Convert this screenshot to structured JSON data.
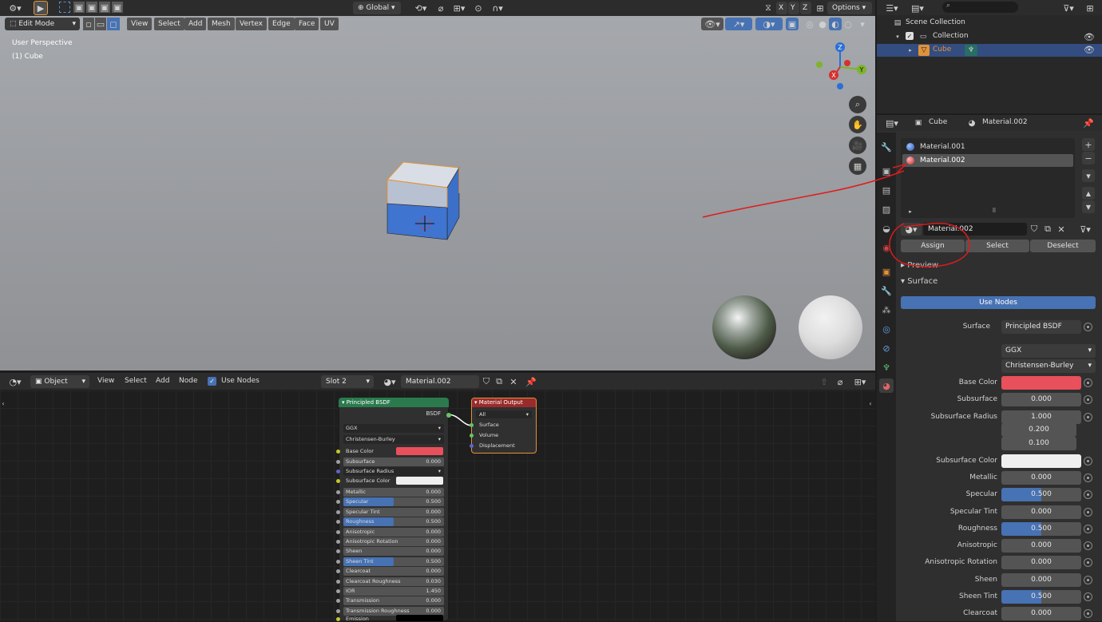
{
  "viewport": {
    "mode": "Edit Mode",
    "menus": [
      "View",
      "Select",
      "Add",
      "Mesh",
      "Vertex",
      "Edge",
      "Face",
      "UV"
    ],
    "transform_orientation": "Global",
    "options_label": "Options",
    "axis_labels": [
      "X",
      "Y",
      "Z"
    ],
    "perspective_label": "User Perspective",
    "object_label": "(1) Cube",
    "gizmo": {
      "x": "X",
      "y": "Y",
      "z": "Z"
    }
  },
  "outliner": {
    "scene_collection": "Scene Collection",
    "collection": "Collection",
    "object": "Cube"
  },
  "properties": {
    "breadcrumb_object": "Cube",
    "breadcrumb_material": "Material.002",
    "slots": [
      "Material.001",
      "Material.002"
    ],
    "material_name": "Material.002",
    "assign_label": "Assign",
    "select_label": "Select",
    "deselect_label": "Deselect",
    "preview_label": "Preview",
    "surface_panel_label": "Surface",
    "use_nodes_label": "Use Nodes",
    "surface_label": "Surface",
    "surface_value": "Principled BSDF",
    "distribution": "GGX",
    "subsurface_method": "Christensen-Burley",
    "rows": [
      {
        "label": "Base Color",
        "type": "color",
        "color": "#e8505b"
      },
      {
        "label": "Subsurface",
        "value": "0.000",
        "fill": 0
      },
      {
        "label": "Subsurface Radius",
        "value": "1.000",
        "fill": 0
      },
      {
        "label": "",
        "value": "0.200",
        "fill": 0
      },
      {
        "label": "",
        "value": "0.100",
        "fill": 0
      },
      {
        "label": "Subsurface Color",
        "type": "color",
        "color": "#efefef"
      },
      {
        "label": "Metallic",
        "value": "0.000",
        "fill": 0
      },
      {
        "label": "Specular",
        "value": "0.500",
        "fill": 0.5
      },
      {
        "label": "Specular Tint",
        "value": "0.000",
        "fill": 0
      },
      {
        "label": "Roughness",
        "value": "0.500",
        "fill": 0.5
      },
      {
        "label": "Anisotropic",
        "value": "0.000",
        "fill": 0
      },
      {
        "label": "Anisotropic Rotation",
        "value": "0.000",
        "fill": 0
      },
      {
        "label": "Sheen",
        "value": "0.000",
        "fill": 0
      },
      {
        "label": "Sheen Tint",
        "value": "0.500",
        "fill": 0.5
      },
      {
        "label": "Clearcoat",
        "value": "0.000",
        "fill": 0
      }
    ]
  },
  "node_editor": {
    "object_mode": "Object",
    "menus": [
      "View",
      "Select",
      "Add",
      "Node"
    ],
    "use_nodes_label": "Use Nodes",
    "slot": "Slot 2",
    "material": "Material.002",
    "bsdf_node": {
      "title": "Principled BSDF",
      "output_label": "BSDF",
      "distribution": "GGX",
      "subsurface_method": "Christensen-Burley",
      "base_color_label": "Base Color",
      "base_color": "#e8505b",
      "subsurface_radius_label": "Subsurface Radius",
      "subsurface_color_label": "Subsurface Color",
      "inputs": [
        {
          "label": "Subsurface",
          "value": "0.000",
          "fill": 0
        },
        {
          "label": "Metallic",
          "value": "0.000",
          "fill": 0
        },
        {
          "label": "Specular",
          "value": "0.500",
          "fill": 0.5
        },
        {
          "label": "Specular Tint",
          "value": "0.000",
          "fill": 0
        },
        {
          "label": "Roughness",
          "value": "0.500",
          "fill": 0.5
        },
        {
          "label": "Anisotropic",
          "value": "0.000",
          "fill": 0
        },
        {
          "label": "Anisotropic Rotation",
          "value": "0.000",
          "fill": 0
        },
        {
          "label": "Sheen",
          "value": "0.000",
          "fill": 0
        },
        {
          "label": "Sheen Tint",
          "value": "0.500",
          "fill": 0.5
        },
        {
          "label": "Clearcoat",
          "value": "0.000",
          "fill": 0
        },
        {
          "label": "Clearcoat Roughness",
          "value": "0.030",
          "fill": 0
        },
        {
          "label": "IOR",
          "value": "1.450",
          "fill": 0
        },
        {
          "label": "Transmission",
          "value": "0.000",
          "fill": 0
        },
        {
          "label": "Transmission Roughness",
          "value": "0.000",
          "fill": 0
        }
      ],
      "emission_label": "Emission"
    },
    "output_node": {
      "title": "Material Output",
      "target": "All",
      "sockets": [
        "Surface",
        "Volume",
        "Displacement"
      ]
    }
  },
  "colors": {
    "accent": "#4772b3",
    "annotation": "#e01b1b",
    "bsdf_header": "#2a7a4e",
    "output_header": "#9a2b2b"
  }
}
